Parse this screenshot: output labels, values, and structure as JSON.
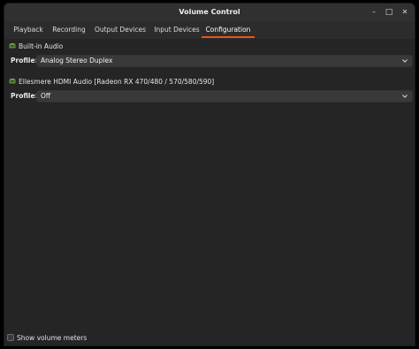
{
  "window": {
    "title": "Volume Control",
    "controls": {
      "minimize_icon": "minimize-icon",
      "maximize_icon": "maximize-icon",
      "close_icon": "close-icon"
    }
  },
  "tabs": [
    {
      "label": "Playback",
      "active": false
    },
    {
      "label": "Recording",
      "active": false
    },
    {
      "label": "Output Devices",
      "active": false
    },
    {
      "label": "Input Devices",
      "active": false
    },
    {
      "label": "Configuration",
      "active": true
    }
  ],
  "cards": [
    {
      "name": "Built-in Audio",
      "profile_label": "Profile:",
      "profile_value": "Analog Stereo Duplex"
    },
    {
      "name": "Ellesmere HDMI Audio [Radeon RX 470/480 / 570/580/590]",
      "profile_label": "Profile:",
      "profile_value": "Off"
    }
  ],
  "footer": {
    "show_meters_label": "Show volume meters",
    "show_meters_checked": false
  },
  "colors": {
    "accent": "#e95420",
    "icon_green": "#6a9955"
  }
}
